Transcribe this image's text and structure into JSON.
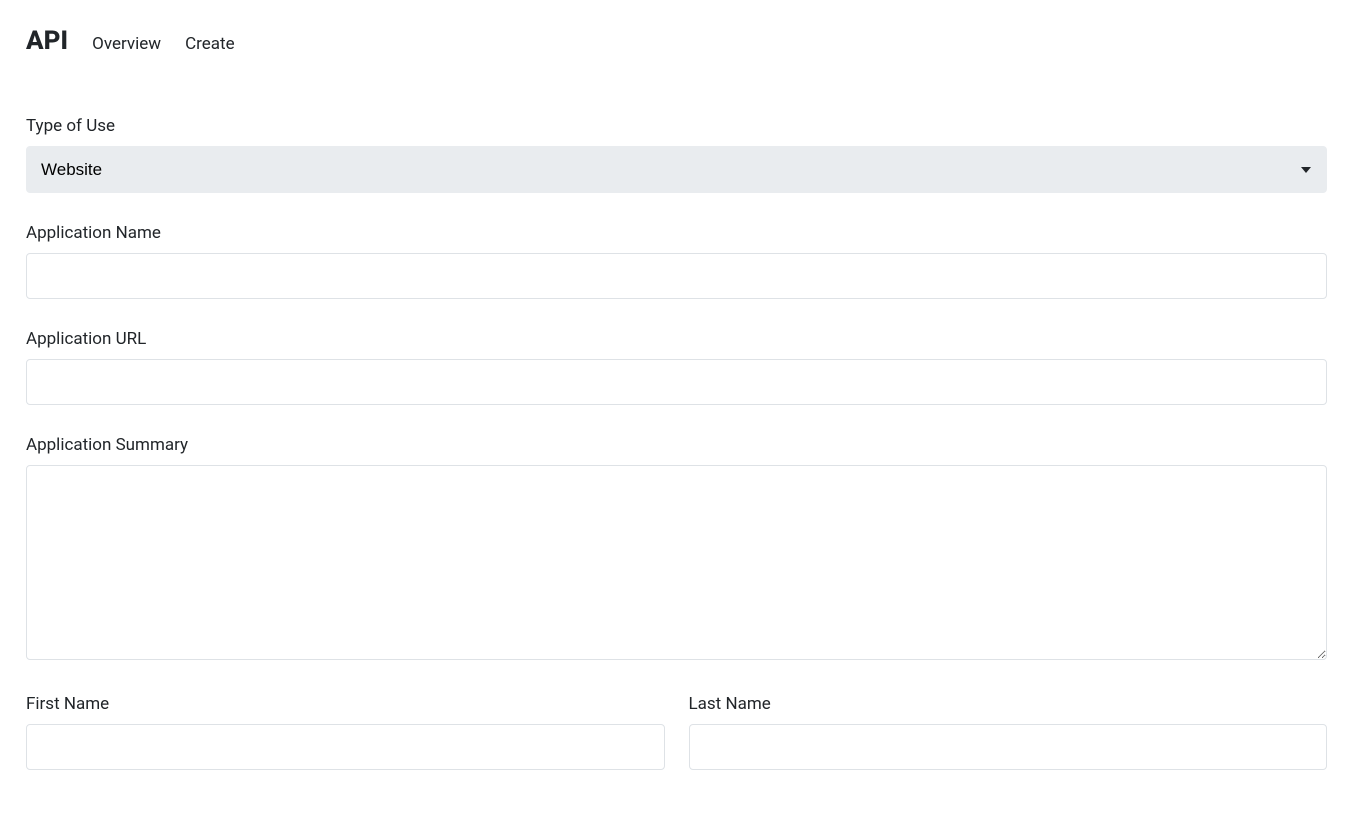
{
  "header": {
    "brand": "API",
    "nav": [
      {
        "label": "Overview"
      },
      {
        "label": "Create"
      }
    ]
  },
  "form": {
    "type_of_use": {
      "label": "Type of Use",
      "selected": "Website"
    },
    "application_name": {
      "label": "Application Name",
      "value": ""
    },
    "application_url": {
      "label": "Application URL",
      "value": ""
    },
    "application_summary": {
      "label": "Application Summary",
      "value": ""
    },
    "first_name": {
      "label": "First Name",
      "value": ""
    },
    "last_name": {
      "label": "Last Name",
      "value": ""
    }
  }
}
